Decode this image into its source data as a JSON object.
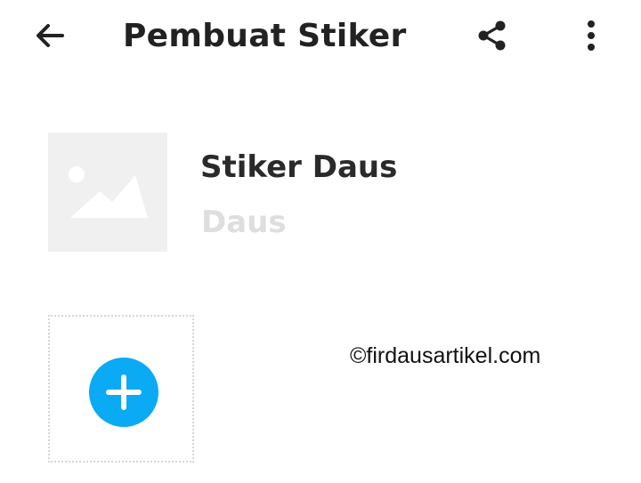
{
  "appbar": {
    "title": "Pembuat Stiker",
    "back_icon": "arrow-left-icon",
    "share_icon": "share-icon",
    "more_icon": "more-vertical-icon"
  },
  "pack": {
    "name": "Stiker Daus",
    "author": "Daus",
    "thumbnail_icon": "image-placeholder-icon"
  },
  "add_sticker": {
    "icon": "plus-icon",
    "accent_color": "#0aaaf5"
  },
  "watermark": "©firdausartikel.com"
}
